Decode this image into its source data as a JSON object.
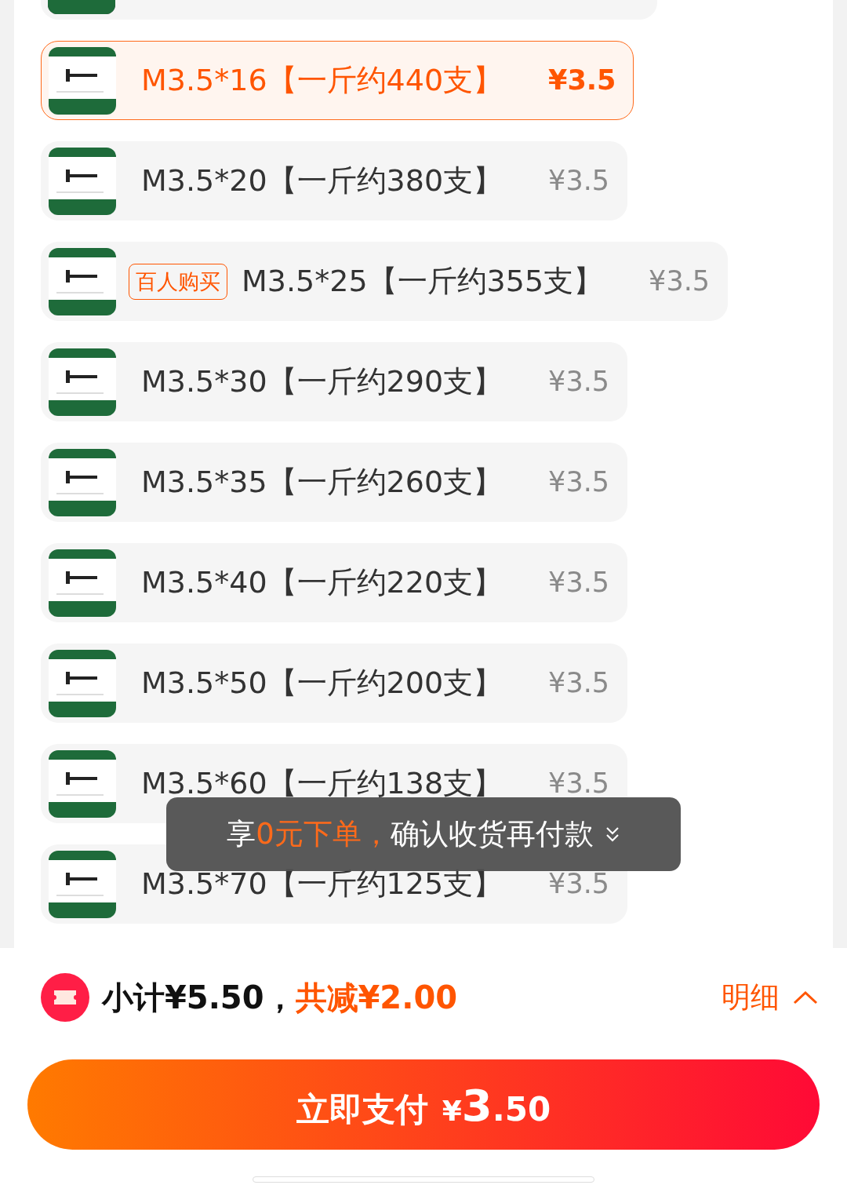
{
  "options": [
    {
      "kind": "partial"
    },
    {
      "kind": "option",
      "label": "M3.5*16【一斤约440支】",
      "price": "¥3.5",
      "selected": true
    },
    {
      "kind": "option",
      "label": "M3.5*20【一斤约380支】",
      "price": "¥3.5",
      "selected": false
    },
    {
      "kind": "option",
      "badge": "百人购买",
      "label": "M3.5*25【一斤约355支】",
      "price": "¥3.5",
      "selected": false
    },
    {
      "kind": "option",
      "label": "M3.5*30【一斤约290支】",
      "price": "¥3.5",
      "selected": false
    },
    {
      "kind": "option",
      "label": "M3.5*35【一斤约260支】",
      "price": "¥3.5",
      "selected": false
    },
    {
      "kind": "option",
      "label": "M3.5*40【一斤约220支】",
      "price": "¥3.5",
      "selected": false
    },
    {
      "kind": "option",
      "label": "M3.5*50【一斤约200支】",
      "price": "¥3.5",
      "selected": false
    },
    {
      "kind": "option",
      "label": "M3.5*60【一斤约138支】",
      "price": "¥3.5",
      "selected": false
    },
    {
      "kind": "option",
      "label": "M3.5*70【一斤约125支】",
      "price": "¥3.5",
      "selected": false
    }
  ],
  "toast": {
    "prefix": "享",
    "highlight": "0元下单，",
    "rest": "确认收货再付款"
  },
  "summary": {
    "subtotal": "小计¥5.50，",
    "discount": "共减¥2.00",
    "details": "明细"
  },
  "pay_button": {
    "label": "立即支付",
    "currency": "¥",
    "integer": "3",
    "decimal": ".50"
  }
}
